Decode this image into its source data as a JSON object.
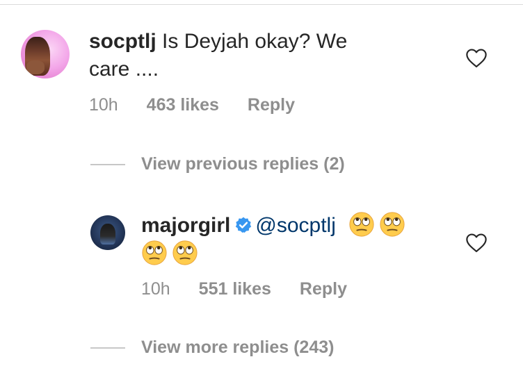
{
  "comments": [
    {
      "username": "socptlj",
      "text_line1": "Is Deyjah okay? We",
      "text_line2": "care ....",
      "time": "10h",
      "likes": "463 likes",
      "reply_label": "Reply"
    },
    {
      "username": "majorgirl",
      "verified": true,
      "mention": "@socptlj",
      "emoji_count_line1": 2,
      "emoji_count_line2": 2,
      "emoji_name": "face-with-rolling-eyes",
      "time": "10h",
      "likes": "551 likes",
      "reply_label": "Reply"
    }
  ],
  "replies": {
    "view_previous": "View previous replies (2)",
    "view_more": "View more replies (243)"
  },
  "colors": {
    "text": "#262626",
    "meta": "#8e8e8e",
    "mention": "#00376b",
    "verified": "#3897f0"
  },
  "icons": {
    "like": "heart-outline-icon",
    "verified": "verified-badge-icon",
    "emoji": "face-with-rolling-eyes"
  }
}
